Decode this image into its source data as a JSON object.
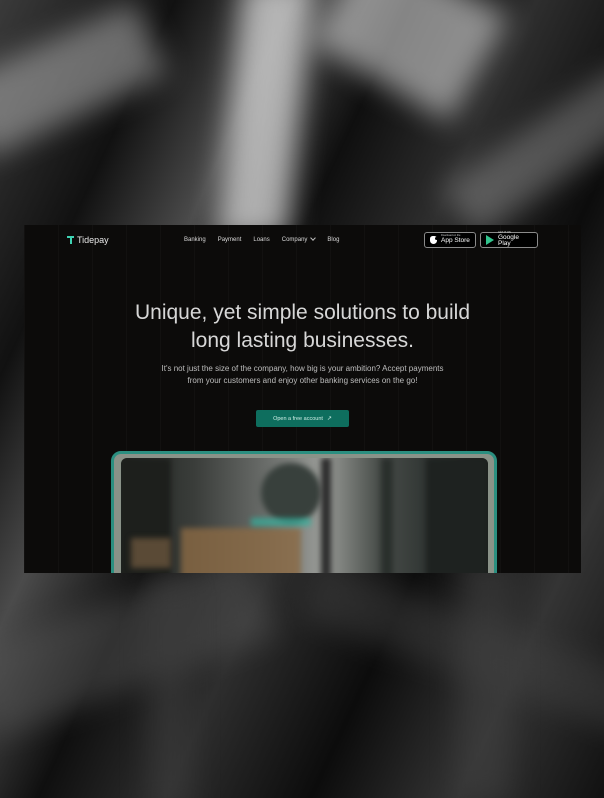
{
  "site": {
    "brand": {
      "name": "Tidepay",
      "accent": "#3fd3b3"
    },
    "nav": {
      "items": [
        {
          "label": "Banking"
        },
        {
          "label": "Payment"
        },
        {
          "label": "Loans"
        },
        {
          "label": "Company",
          "has_dropdown": true
        },
        {
          "label": "Blog"
        }
      ]
    },
    "stores": {
      "apple": {
        "small": "Download on the",
        "big": "App Store"
      },
      "google": {
        "small": "GET IT ON",
        "big": "Google Play"
      }
    },
    "hero": {
      "title_line1": "Unique, yet simple solutions to build",
      "title_line2": "long lasting businesses.",
      "subtitle_line1": "It's not just the size of the company, how big is your ambition? Accept payments",
      "subtitle_line2": "from your customers and enjoy other banking services on the go!",
      "cta_label": "Open a free account",
      "cta_color": "#0e6e5e"
    },
    "preview_frame_color": "#2b8f80"
  }
}
